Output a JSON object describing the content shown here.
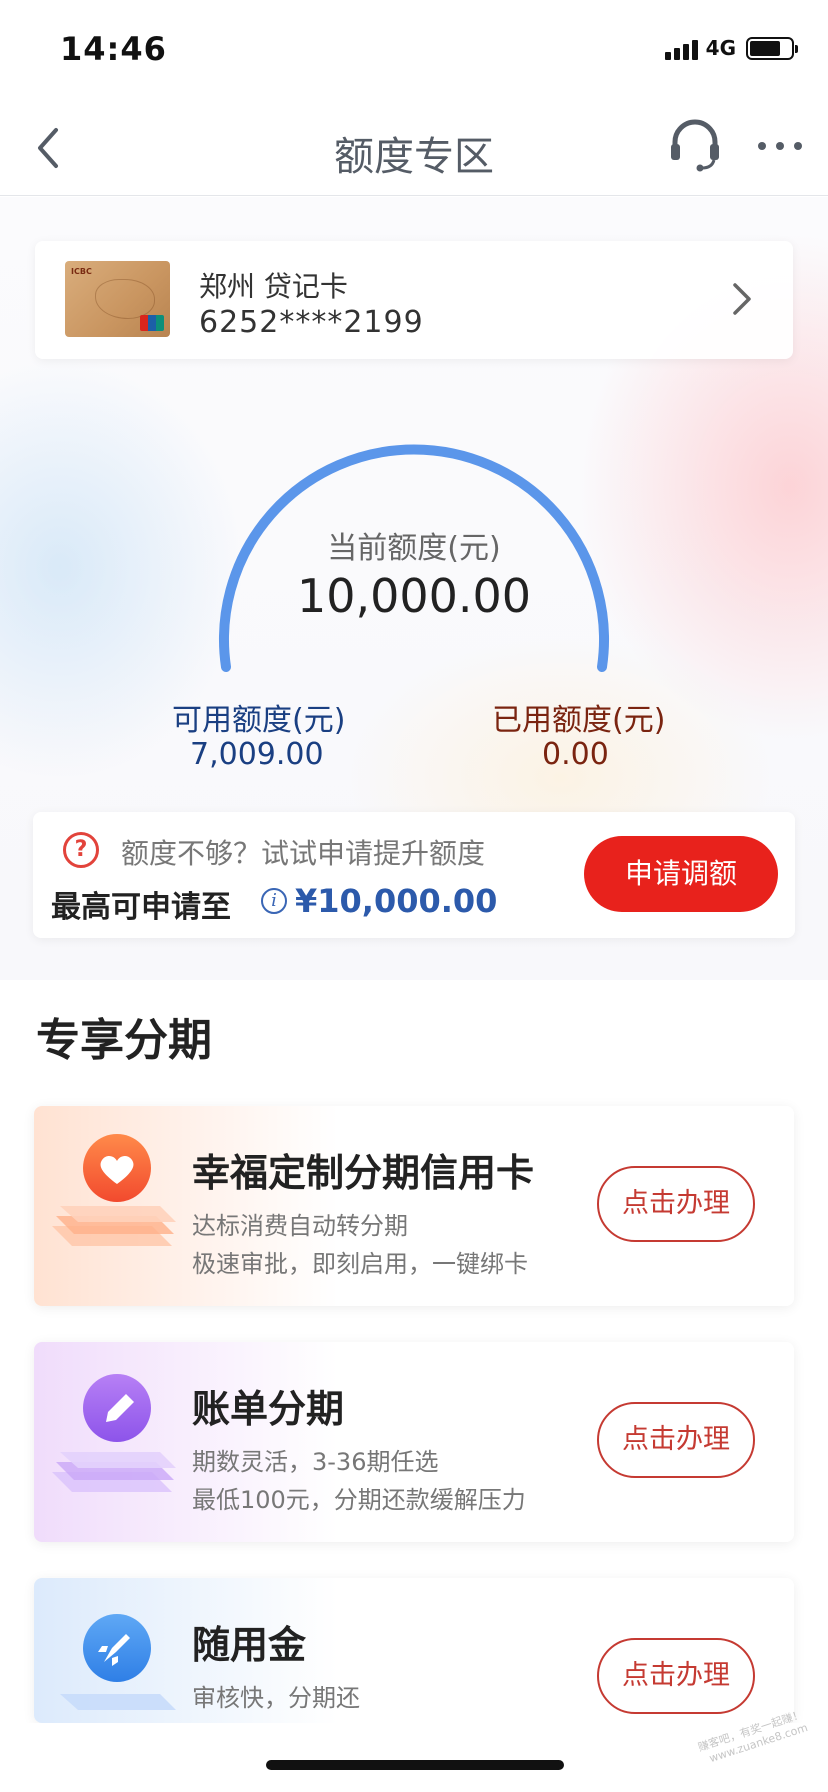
{
  "status_bar": {
    "time": "14:46",
    "network": "4G",
    "battery_level": 0.75
  },
  "nav": {
    "title": "额度专区",
    "back_icon": "chevron-left-icon",
    "service_icon": "headset-icon",
    "more_icon": "more-dots-icon"
  },
  "card": {
    "name": "郑州 贷记卡",
    "number": "6252****2199",
    "brand_color": "#c99560"
  },
  "limit": {
    "current_label": "当前额度(元)",
    "current_value": "10,000.00",
    "available_label": "可用额度(元)",
    "available_value": "7,009.00",
    "used_label": "已用额度(元)",
    "used_value": "0.00",
    "gauge_color": "#5b96ea"
  },
  "raise": {
    "hint": "额度不够？试试申请提升额度",
    "max_label": "最高可申请至",
    "max_amount": "¥10,000.00",
    "button": "申请调额",
    "button_color": "#e8221c"
  },
  "section_title": "专享分期",
  "products": [
    {
      "title": "幸福定制分期信用卡",
      "line1": "达标消费自动转分期",
      "line2": "极速审批，即刻启用，一键绑卡",
      "button": "点击办理",
      "icon": "heart-icon"
    },
    {
      "title": "账单分期",
      "line1": "期数灵活，3-36期任选",
      "line2": "最低100元，分期还款缓解压力",
      "button": "点击办理",
      "icon": "pencil-icon"
    },
    {
      "title": "随用金",
      "line1": "审核快，分期还",
      "button": "点击办理",
      "icon": "rocket-icon"
    }
  ],
  "watermark": {
    "line1": "赚客吧，有奖一起赚！",
    "line2": "www.zuanke8.com"
  }
}
